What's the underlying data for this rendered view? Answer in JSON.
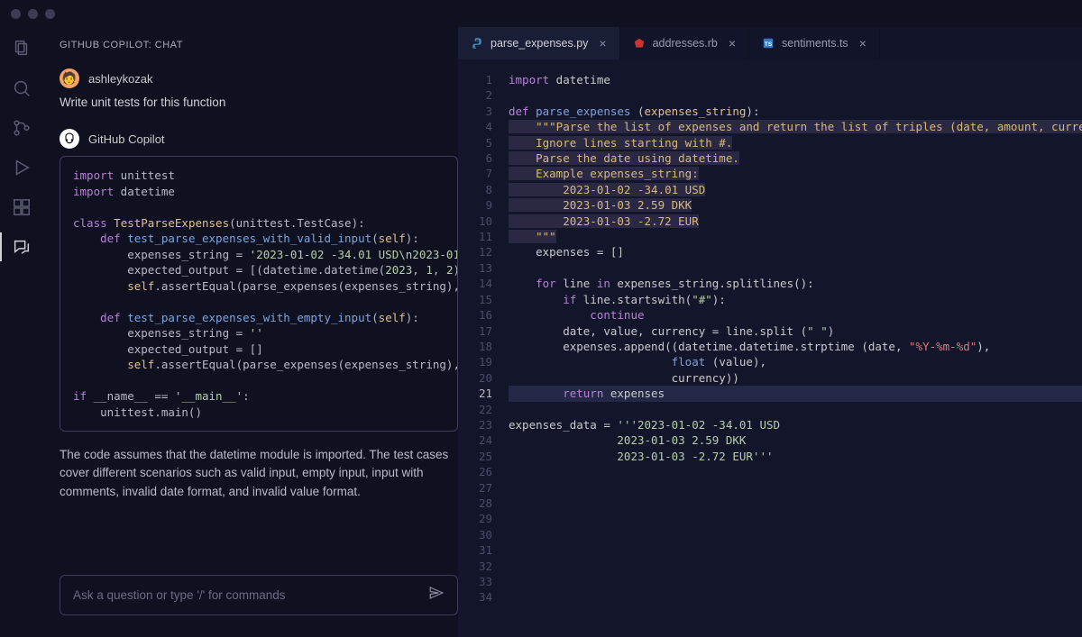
{
  "panel": {
    "title": "GITHUB COPILOT: CHAT",
    "user": "ashleykozak",
    "prompt": "Write unit tests for this function",
    "bot": "GitHub Copilot",
    "explanation": "The code assumes that the datetime module is imported. The test cases cover different scenarios such as valid input, empty input, input with comments, invalid date format, and invalid value format.",
    "input_placeholder": "Ask a question or type '/' for commands"
  },
  "copilot_code": {
    "l1a": "import",
    "l1b": " unittest",
    "l2a": "import",
    "l2b": " datetime",
    "l4a": "class",
    "l4b": " TestParseExpenses",
    "l4c": "(unittest.TestCase):",
    "l5a": "    def",
    "l5b": " test_parse_expenses_with_valid_input",
    "l5c": "(",
    "l5d": "self",
    "l5e": "):",
    "l6a": "        expenses_string = ",
    "l6b": "'2023-01-02 -34.01 USD\\n2023-01",
    "l7a": "        expected_output = [(datetime.datetime(",
    "l7b": "2023",
    "l7c": ", ",
    "l7d": "1",
    "l7e": ", ",
    "l7f": "2",
    "l7g": ")",
    "l8a": "        ",
    "l8b": "self",
    "l8c": ".assertEqual(parse_expenses(expenses_string),",
    "l10a": "    def",
    "l10b": " test_parse_expenses_with_empty_input",
    "l10c": "(",
    "l10d": "self",
    "l10e": "):",
    "l11a": "        expenses_string = ",
    "l11b": "''",
    "l12": "        expected_output = []",
    "l13a": "        ",
    "l13b": "self",
    "l13c": ".assertEqual(parse_expenses(expenses_string),",
    "l15a": "if",
    "l15b": " __name__ == ",
    "l15c": "'__main__'",
    "l15d": ":",
    "l16": "    unittest.main()"
  },
  "tabs": [
    {
      "label": "parse_expenses.py",
      "icon_color": "#4b8bbe",
      "active": true
    },
    {
      "label": "addresses.rb",
      "icon_color": "#cc342d",
      "active": false
    },
    {
      "label": "sentiments.ts",
      "icon_color": "#3178c6",
      "active": false
    }
  ],
  "editor": {
    "line_count": 34,
    "current_line": 21,
    "l1a": "import",
    "l1b": " datetime",
    "l3a": "def",
    "l3b": " parse_expenses",
    "l3c": " (",
    "l3d": "expenses_string",
    "l3e": "):",
    "l4": "    \"\"\"Parse the list of expenses and return the list of triples (date, amount, currency).",
    "l5": "    Ignore lines starting with #.",
    "l6": "    Parse the date using datetime.",
    "l7": "    Example expenses_string:",
    "l8": "        2023-01-02 -34.01 USD",
    "l9": "        2023-01-03 2.59 DKK",
    "l10": "        2023-01-03 -2.72 EUR",
    "l11": "    \"\"\"",
    "l12": "    expenses = []",
    "l14a": "    for",
    "l14b": " line ",
    "l14c": "in",
    "l14d": " expenses_string.splitlines():",
    "l15a": "        if",
    "l15b": " line.startswith(",
    "l15c": "\"#\"",
    "l15d": "):",
    "l16a": "            continue",
    "l17a": "        date, value, currency = line.split (",
    "l17b": "\" \"",
    "l17c": ")",
    "l18a": "        expenses.append((datetime.datetime.strptime (date, ",
    "l18b": "\"%Y-%m-%d\"",
    "l18c": "),",
    "l19a": "                        ",
    "l19b": "float",
    "l19c": " (value),",
    "l20": "                        currency))",
    "l21a": "        return",
    "l21b": " expenses",
    "l23a": "expenses_data = ",
    "l23b": "'''2023-01-02 -34.01 USD",
    "l24": "                2023-01-03 2.59 DKK",
    "l25": "                2023-01-03 -2.72 EUR'''"
  }
}
